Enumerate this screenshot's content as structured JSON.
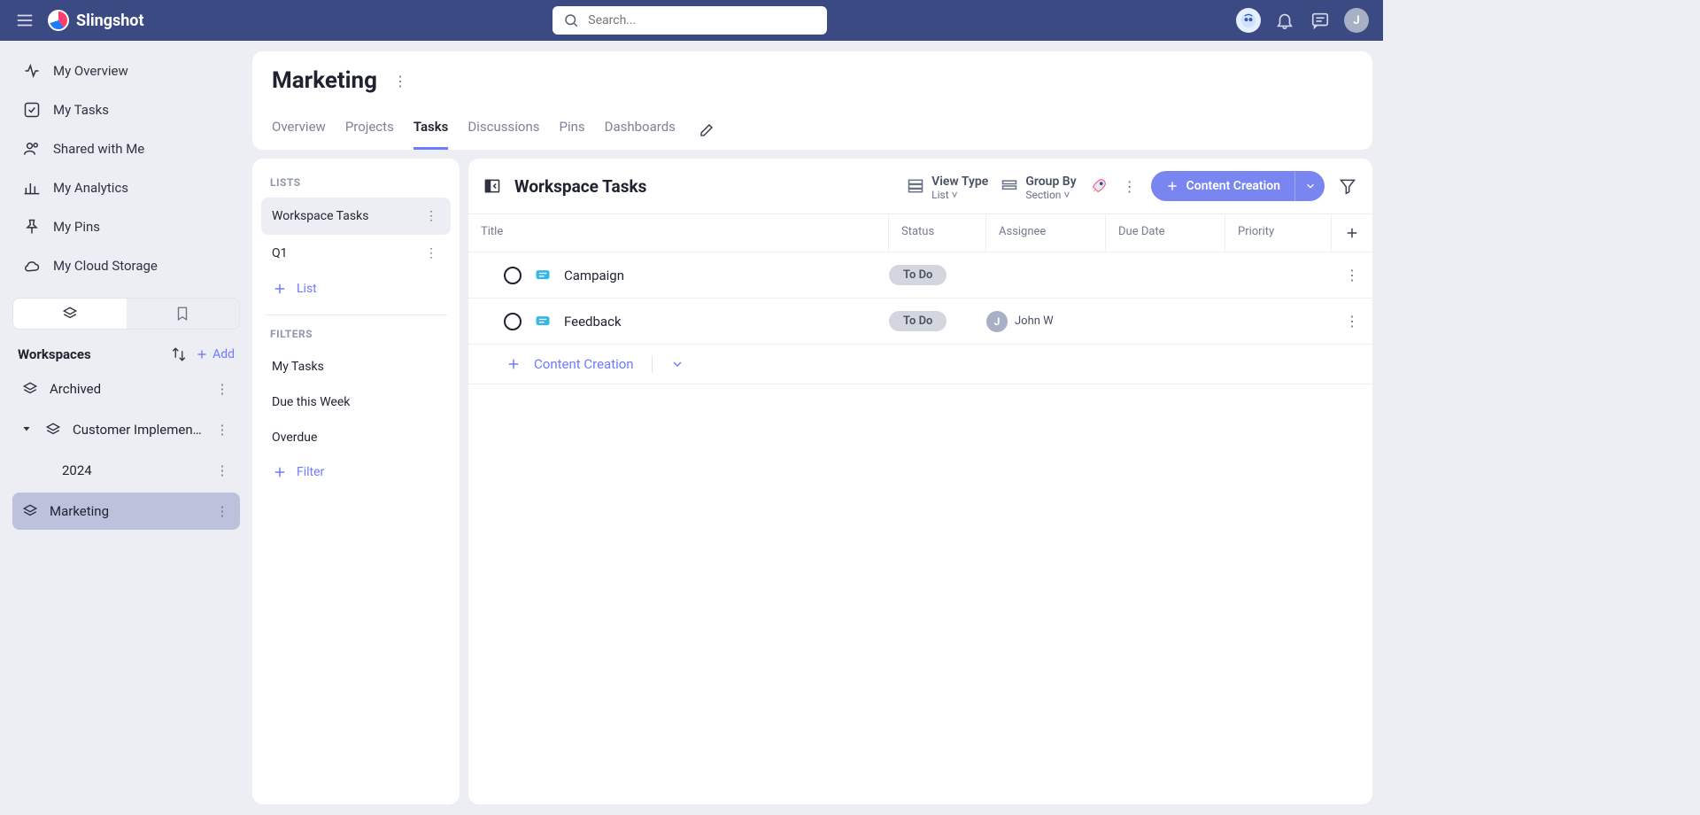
{
  "brand": "Slingshot",
  "search": {
    "placeholder": "Search..."
  },
  "topIcons": {
    "userInitial": "J"
  },
  "leftNav": {
    "items": [
      {
        "label": "My Overview"
      },
      {
        "label": "My Tasks"
      },
      {
        "label": "Shared with Me"
      },
      {
        "label": "My Analytics"
      },
      {
        "label": "My Pins"
      },
      {
        "label": "My Cloud Storage"
      }
    ],
    "workspacesLabel": "Workspaces",
    "addLabel": "Add",
    "workspaces": [
      {
        "label": "Archived"
      },
      {
        "label": "Customer Implementa...",
        "expanded": true,
        "children": [
          {
            "label": "2024"
          }
        ]
      },
      {
        "label": "Marketing",
        "active": true
      }
    ]
  },
  "page": {
    "title": "Marketing",
    "tabs": [
      "Overview",
      "Projects",
      "Tasks",
      "Discussions",
      "Pins",
      "Dashboards"
    ],
    "activeTab": "Tasks"
  },
  "lists": {
    "sectionLabel": "LISTS",
    "items": [
      {
        "label": "Workspace Tasks",
        "active": true
      },
      {
        "label": "Q1"
      }
    ],
    "addLabel": "List",
    "filtersLabel": "FILTERS",
    "filters": [
      "My Tasks",
      "Due this Week",
      "Overdue"
    ],
    "addFilterLabel": "Filter"
  },
  "tasksPanel": {
    "title": "Workspace Tasks",
    "viewType": {
      "title": "View Type",
      "value": "List"
    },
    "groupBy": {
      "title": "Group By",
      "value": "Section"
    },
    "primaryAction": "Content Creation",
    "columns": [
      "Title",
      "Status",
      "Assignee",
      "Due Date",
      "Priority"
    ],
    "rows": [
      {
        "title": "Campaign",
        "status": "To Do",
        "assignee": ""
      },
      {
        "title": "Feedback",
        "status": "To Do",
        "assignee": "John W",
        "assigneeInitial": "J"
      }
    ],
    "quickAdd": "Content Creation"
  }
}
